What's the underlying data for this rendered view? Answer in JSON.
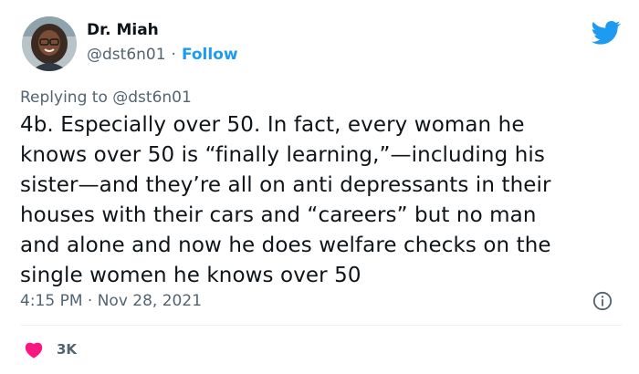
{
  "author": {
    "display_name": "Dr. Miah",
    "handle": "@dst6n01",
    "separator": "·",
    "follow_label": "Follow",
    "avatar_icon": "profile-photo"
  },
  "brand": {
    "icon": "twitter-bird-icon",
    "color": "#1d9bf0"
  },
  "reply": {
    "prefix": "Replying to",
    "mention": "@dst6n01"
  },
  "tweet": {
    "lines": [
      "4b. Especially over 50. In fact, every woman he",
      "knows over 50 is “finally learning,”—including his",
      "sister—and they’re all on anti depressants in their",
      "houses with their cars and “careers” but no man",
      "and alone and now he does welfare checks on the",
      "single women he knows over 50"
    ]
  },
  "meta": {
    "time": "4:15 PM",
    "separator": "·",
    "date": "Nov 28, 2021",
    "info_icon": "info-icon"
  },
  "engagement": {
    "like_icon": "heart-icon",
    "like_color": "#f91880",
    "likes": "3K"
  }
}
